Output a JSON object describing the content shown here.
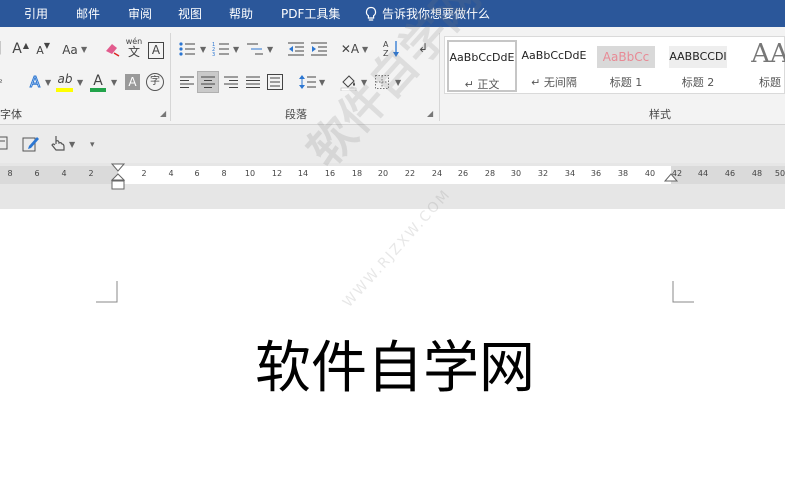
{
  "menu": {
    "items": [
      "引用",
      "邮件",
      "审阅",
      "视图",
      "帮助",
      "PDF工具集"
    ],
    "tell_me": "告诉我你想要做什么"
  },
  "ribbon": {
    "groups": {
      "font": "字体",
      "paragraph": "段落",
      "styles": "样式"
    },
    "font_icons": {
      "grow": "A",
      "shrink": "A",
      "case": "Aa",
      "clear": "clear-formatting",
      "phonetic_top": "wén",
      "phonetic_bottom": "文",
      "border_char": "A",
      "text_effect": "A",
      "highlight": "ab",
      "font_color": "A",
      "shade": "A",
      "enclose": "字"
    },
    "styles": [
      {
        "preview": "AaBbCcDdE",
        "name": "正文"
      },
      {
        "preview": "AaBbCcDdE",
        "name": "无间隔"
      },
      {
        "preview": "AaBbCc",
        "name": "标题 1"
      },
      {
        "preview": "AABBCCDI",
        "name": "标题 2"
      },
      {
        "preview": "AA",
        "name": "标题"
      }
    ],
    "style_marks": [
      "↵",
      "↵"
    ]
  },
  "ruler": {
    "left_numbers": [
      "8",
      "6",
      "4",
      "2"
    ],
    "right_numbers": [
      "2",
      "4",
      "6",
      "8",
      "10",
      "12",
      "14",
      "16",
      "18",
      "20",
      "22",
      "24",
      "26",
      "28",
      "30",
      "32",
      "34",
      "36",
      "38",
      "40",
      "42",
      "44",
      "46",
      "48",
      "50"
    ]
  },
  "document": {
    "content": "软件自学网",
    "watermark": "软件自学网",
    "watermark_url": "WWW.RJZXW.COM"
  },
  "colors": {
    "menu_bg": "#2b579a",
    "highlight": "#ffff00",
    "font_color": "#22a34a",
    "heading1": "#e88a95"
  }
}
